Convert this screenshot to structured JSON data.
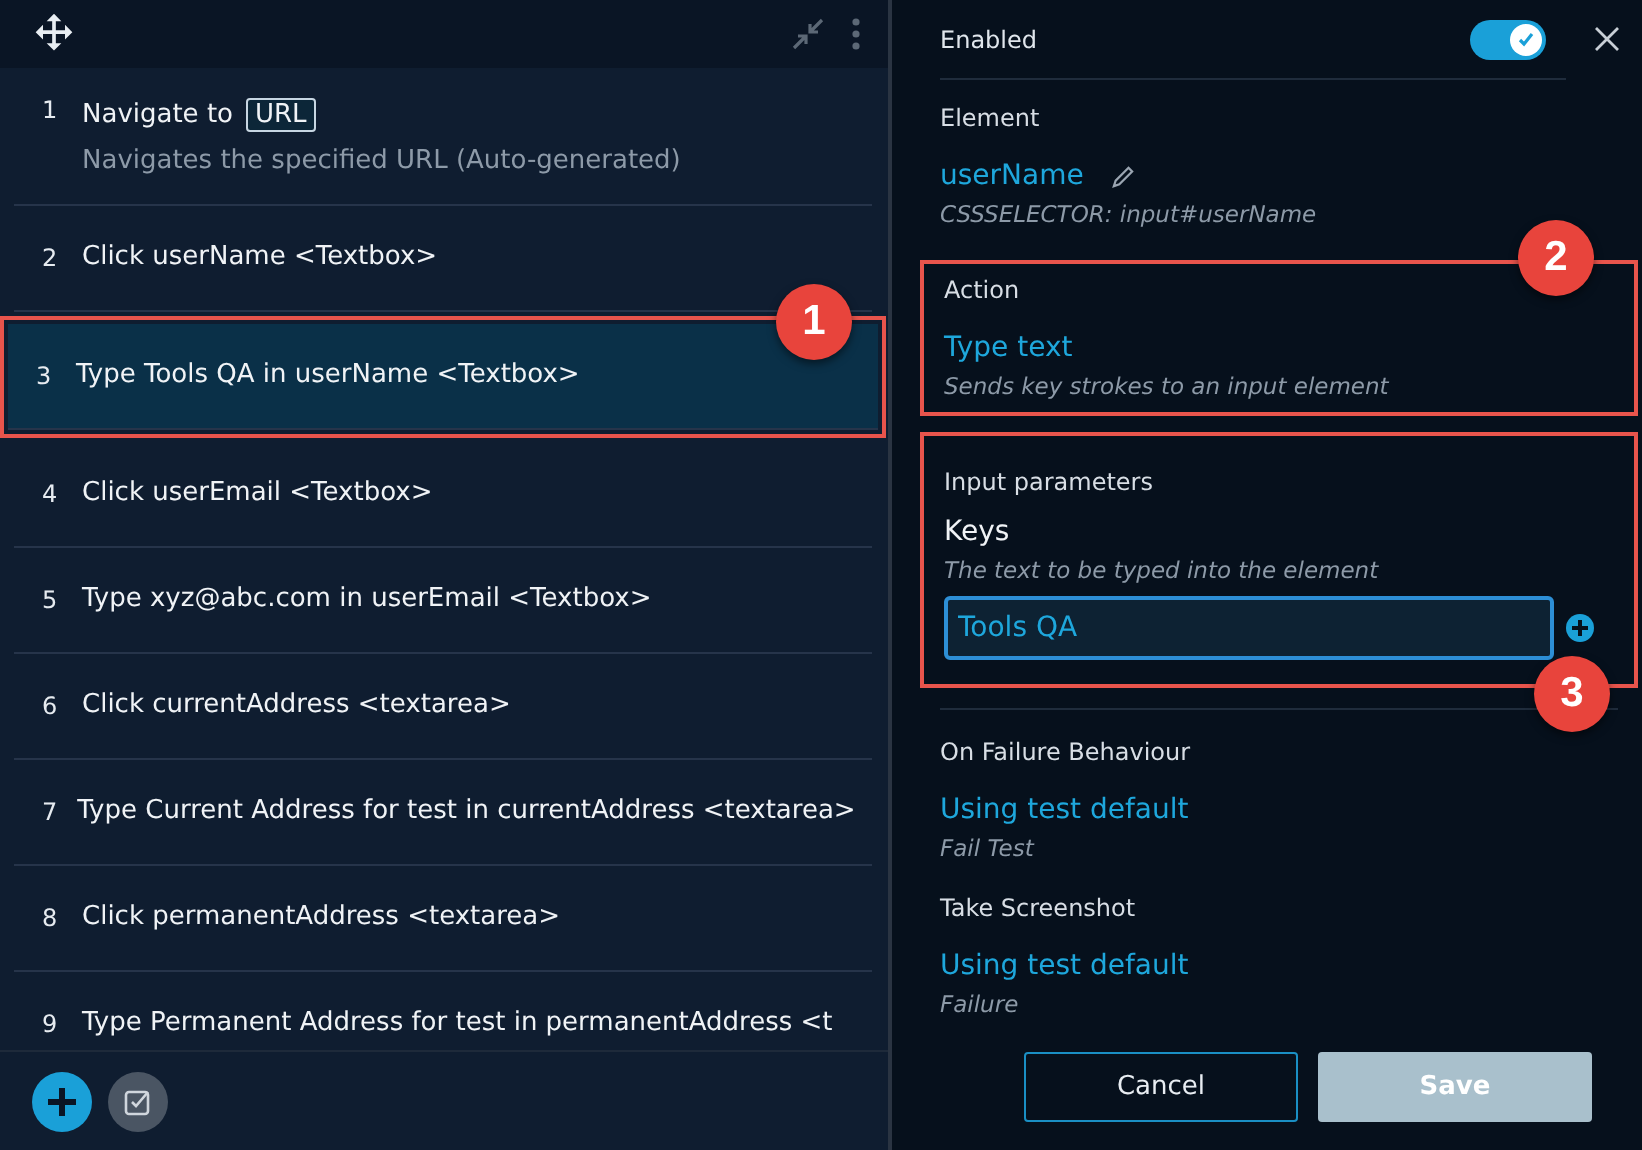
{
  "steps_panel": {
    "steps": [
      {
        "number": "1",
        "kind": "navigate",
        "text": "Navigate to",
        "chip": "URL",
        "description": "Navigates the specified URL (Auto-generated)",
        "selected": false
      },
      {
        "number": "2",
        "kind": "plain",
        "text": "Click userName <Textbox>",
        "selected": false
      },
      {
        "number": "3",
        "kind": "plain",
        "text": "Type Tools QA in userName <Textbox>",
        "selected": true,
        "callout": "1"
      },
      {
        "number": "4",
        "kind": "plain",
        "text": "Click userEmail <Textbox>",
        "selected": false
      },
      {
        "number": "5",
        "kind": "plain",
        "text": "Type xyz@abc.com in userEmail <Textbox>",
        "selected": false
      },
      {
        "number": "6",
        "kind": "plain",
        "text": "Click currentAddress <textarea>",
        "selected": false
      },
      {
        "number": "7",
        "kind": "plain",
        "text": "Type Current Address for test in currentAddress <textarea>",
        "selected": false
      },
      {
        "number": "8",
        "kind": "plain",
        "text": "Click permanentAddress <textarea>",
        "selected": false
      },
      {
        "number": "9",
        "kind": "plain",
        "text": "Type Permanent Address for test in permanentAddress <t",
        "selected": false
      }
    ]
  },
  "details": {
    "enabled": {
      "label": "Enabled",
      "on": true
    },
    "element": {
      "label": "Element",
      "name": "userName",
      "selector": "CSSSELECTOR: input#userName"
    },
    "action": {
      "label": "Action",
      "value": "Type text",
      "description": "Sends key strokes to an input element",
      "callout": "2"
    },
    "input_parameters": {
      "label": "Input parameters",
      "param_name": "Keys",
      "param_hint": "The text to be typed into the element",
      "value": "Tools QA",
      "callout": "3"
    },
    "on_failure": {
      "label": "On Failure Behaviour",
      "value": "Using test default",
      "description": "Fail Test"
    },
    "screenshot": {
      "label": "Take Screenshot",
      "value": "Using test default",
      "description": "Failure"
    },
    "buttons": [
      {
        "label": "Cancel",
        "kind": "secondary",
        "disabled": false
      },
      {
        "label": "Save",
        "kind": "primary",
        "disabled": true
      }
    ]
  }
}
